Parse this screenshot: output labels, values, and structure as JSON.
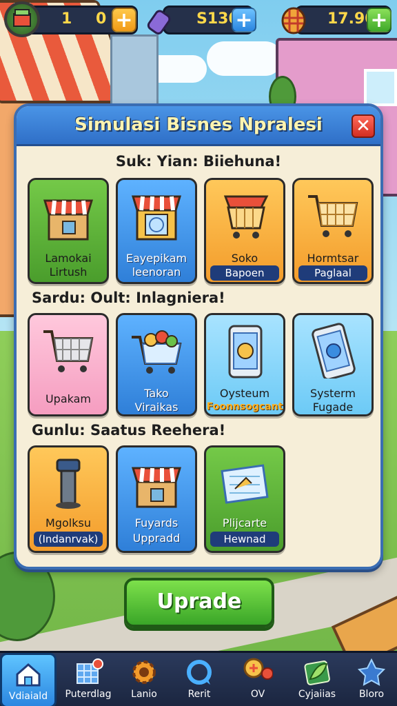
{
  "hud": {
    "level_value": "1",
    "gems_value": "0",
    "cash_value": "S130",
    "coins_value": "17.90",
    "plus_symbol": "+"
  },
  "panel": {
    "title": "Simulasi Bisnes Npralesi",
    "close_symbol": "✕",
    "sections": [
      {
        "title": "Suk: Yian: Biiehuna!",
        "cards": [
          {
            "line1": "Lamokai",
            "line2": "Lirtush",
            "color": "green",
            "icon": "shop-icon"
          },
          {
            "line1": "Eayepikam",
            "line2": "leenoran",
            "color": "blue",
            "icon": "shop-clock-icon"
          },
          {
            "line1": "Soko",
            "line2": "Bapoen",
            "color": "orange",
            "icon": "shop-cart-icon"
          },
          {
            "line1": "Hormtsar",
            "line2": "Paglaal",
            "color": "orange",
            "icon": "shopping-cart-icon"
          }
        ]
      },
      {
        "title": "Sardu: Oult: Inlagniera!",
        "cards": [
          {
            "line1": "Upakam",
            "line2": "",
            "color": "pink",
            "icon": "shopping-cart-icon"
          },
          {
            "line1": "Tako",
            "line2": "Viraikas",
            "color": "blue",
            "icon": "full-cart-icon"
          },
          {
            "line1": "Oysteum",
            "line2": "Foonnsogcant",
            "color": "lblue",
            "icon": "tablet-icon"
          },
          {
            "line1": "Systerm",
            "line2": "Fugade",
            "color": "lblue",
            "icon": "tablet-icon"
          }
        ]
      },
      {
        "title": "Gunlu: Saatus Reehera!",
        "cards": [
          {
            "line1": "Mgolksu",
            "line2": "(Indanrvak)",
            "color": "orange",
            "icon": "pillar-icon"
          },
          {
            "line1": "Fuyards",
            "line2": "Uppradd",
            "color": "blue",
            "icon": "shop-icon"
          },
          {
            "line1": "Plijcarte",
            "line2": "Hewnad",
            "color": "green",
            "icon": "blueprint-icon"
          }
        ]
      }
    ]
  },
  "upgrade_button": {
    "label": "Uprade"
  },
  "bottom_nav": [
    {
      "label": "Vdiaiald",
      "icon": "home-icon",
      "active": true
    },
    {
      "label": "Puterdlag",
      "icon": "calendar-icon",
      "active": false
    },
    {
      "label": "Lanio",
      "icon": "gear-icon",
      "active": false
    },
    {
      "label": "Rerit",
      "icon": "refresh-icon",
      "active": false
    },
    {
      "label": "OV",
      "icon": "coins-icon",
      "active": false
    },
    {
      "label": "Cyjaiias",
      "icon": "leaf-card-icon",
      "active": false
    },
    {
      "label": "Bloro",
      "icon": "star-badge-icon",
      "active": false
    }
  ]
}
